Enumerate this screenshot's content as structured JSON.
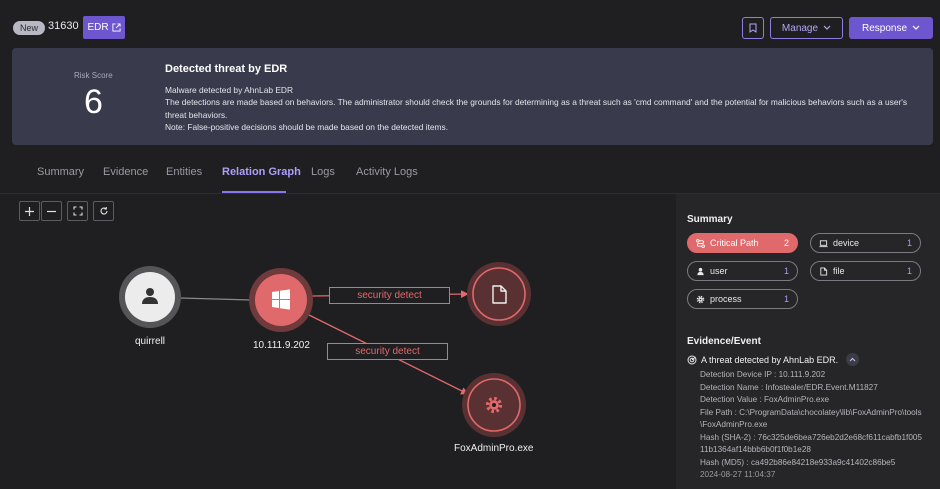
{
  "topbar": {
    "badge": "New",
    "incident_id": "31630",
    "edr_label": "EDR",
    "manage_label": "Manage",
    "response_label": "Response"
  },
  "threat": {
    "risk_label": "Risk Score",
    "risk_value": "6",
    "title": "Detected threat by EDR",
    "lines": [
      "Malware detected by AhnLab EDR",
      "The detections are made based on behaviors. The administrator should check the grounds for determining as a threat such as 'cmd command' and the potential for malicious behaviors such as a user's threat behaviors.",
      "Note: False-positive decisions should be made based on the detected items."
    ]
  },
  "tabs": [
    "Summary",
    "Evidence",
    "Entities",
    "Relation Graph",
    "Logs",
    "Activity Logs"
  ],
  "active_tab": "Relation Graph",
  "graph": {
    "nodes": {
      "user": "quirrell",
      "device": "10.111.9.202",
      "file": "",
      "process": "FoxAdminPro.exe"
    },
    "edges": {
      "to_file": "security detect",
      "to_process": "security detect"
    },
    "colors": {
      "critical": "#e3696b",
      "neutral": "#e8e8e8"
    }
  },
  "summary": {
    "title": "Summary",
    "chips": {
      "critical_path": {
        "label": "Critical Path",
        "count": "2"
      },
      "device": {
        "label": "device",
        "count": "1"
      },
      "user": {
        "label": "user",
        "count": "1"
      },
      "file": {
        "label": "file",
        "count": "1"
      },
      "process": {
        "label": "process",
        "count": "1"
      }
    }
  },
  "evidence": {
    "title": "Evidence/Event",
    "headline": "A threat detected by AhnLab EDR.",
    "lines": [
      "Detection Device IP : 10.111.9.202",
      "Detection Name : Infostealer/EDR.Event.M11827",
      "Detection Value : FoxAdminPro.exe",
      "File Path : C:\\ProgramData\\chocolatey\\lib\\FoxAdminPro\\tools\\FoxAdminPro.exe",
      "Hash (SHA-2) : 76c325de6bea726eb2d2e68cf611cabfb1f00511b1364af14bbb6b0f1f0b1e28",
      "Hash (MD5) : ca492b86e84218e933a9c41402c86be5"
    ],
    "timestamp": "2024-08-27 11:04:37"
  }
}
